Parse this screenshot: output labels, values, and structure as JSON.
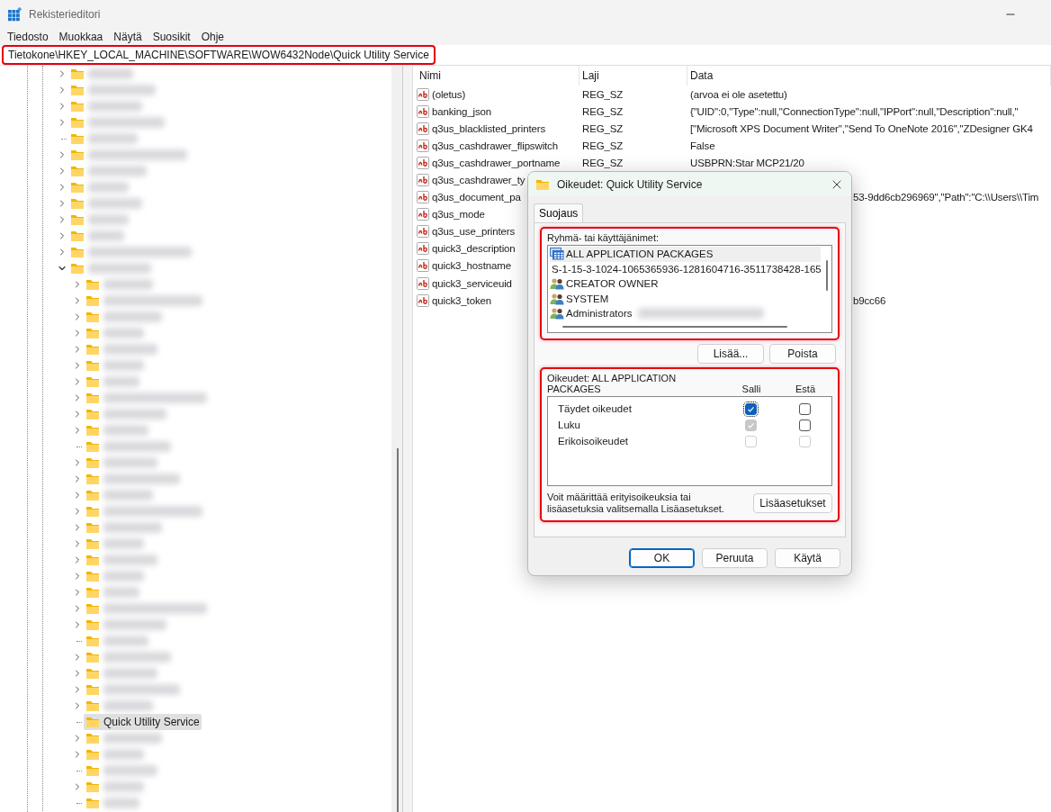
{
  "window": {
    "title": "Rekisterieditori"
  },
  "menu": [
    "Tiedosto",
    "Muokkaa",
    "Näytä",
    "Suosikit",
    "Ohje"
  ],
  "address_bar": {
    "value": "Tietokone\\HKEY_LOCAL_MACHINE\\SOFTWARE\\WOW6432Node\\Quick Utility Service",
    "highlighted": true
  },
  "tree": {
    "items": [
      {
        "expandable": true,
        "expanded": false,
        "redacted": true,
        "selected": false
      },
      {
        "expandable": true,
        "expanded": false,
        "redacted": true,
        "selected": false
      },
      {
        "expandable": true,
        "expanded": false,
        "redacted": true,
        "selected": false
      },
      {
        "expandable": true,
        "expanded": false,
        "redacted": true,
        "selected": false
      },
      {
        "expandable": false,
        "expanded": false,
        "redacted": true,
        "selected": false
      },
      {
        "expandable": true,
        "expanded": false,
        "redacted": true,
        "selected": false
      },
      {
        "expandable": true,
        "expanded": false,
        "redacted": true,
        "selected": false
      },
      {
        "expandable": true,
        "expanded": false,
        "redacted": true,
        "selected": false
      },
      {
        "expandable": true,
        "expanded": false,
        "redacted": true,
        "selected": false
      },
      {
        "expandable": true,
        "expanded": false,
        "redacted": true,
        "selected": false
      },
      {
        "expandable": true,
        "expanded": false,
        "redacted": true,
        "selected": false
      },
      {
        "expandable": true,
        "expanded": false,
        "redacted": true,
        "selected": false
      },
      {
        "expandable": true,
        "expanded": true,
        "redacted": true,
        "selected": false,
        "children": [
          {
            "expandable": true,
            "expanded": false,
            "redacted": true,
            "selected": false
          },
          {
            "expandable": true,
            "expanded": false,
            "redacted": true,
            "selected": false
          },
          {
            "expandable": true,
            "expanded": false,
            "redacted": true,
            "selected": false
          },
          {
            "expandable": true,
            "expanded": false,
            "redacted": true,
            "selected": false
          },
          {
            "expandable": true,
            "expanded": false,
            "redacted": true,
            "selected": false
          },
          {
            "expandable": true,
            "expanded": false,
            "redacted": true,
            "selected": false
          },
          {
            "expandable": true,
            "expanded": false,
            "redacted": true,
            "selected": false
          },
          {
            "expandable": true,
            "expanded": false,
            "redacted": true,
            "selected": false
          },
          {
            "expandable": true,
            "expanded": false,
            "redacted": true,
            "selected": false
          },
          {
            "expandable": true,
            "expanded": false,
            "redacted": true,
            "selected": false
          },
          {
            "expandable": false,
            "expanded": false,
            "redacted": true,
            "selected": false
          },
          {
            "expandable": true,
            "expanded": false,
            "redacted": true,
            "selected": false
          },
          {
            "expandable": true,
            "expanded": false,
            "redacted": true,
            "selected": false
          },
          {
            "expandable": true,
            "expanded": false,
            "redacted": true,
            "selected": false
          },
          {
            "expandable": true,
            "expanded": false,
            "redacted": true,
            "selected": false
          },
          {
            "expandable": true,
            "expanded": false,
            "redacted": true,
            "selected": false
          },
          {
            "expandable": true,
            "expanded": false,
            "redacted": true,
            "selected": false
          },
          {
            "expandable": true,
            "expanded": false,
            "redacted": true,
            "selected": false
          },
          {
            "expandable": true,
            "expanded": false,
            "redacted": true,
            "selected": false
          },
          {
            "expandable": true,
            "expanded": false,
            "redacted": true,
            "selected": false
          },
          {
            "expandable": true,
            "expanded": false,
            "redacted": true,
            "selected": false
          },
          {
            "expandable": true,
            "expanded": false,
            "redacted": true,
            "selected": false
          },
          {
            "expandable": false,
            "expanded": false,
            "redacted": true,
            "selected": false
          },
          {
            "expandable": true,
            "expanded": false,
            "redacted": true,
            "selected": false
          },
          {
            "expandable": true,
            "expanded": false,
            "redacted": true,
            "selected": false
          },
          {
            "expandable": true,
            "expanded": false,
            "redacted": true,
            "selected": false
          },
          {
            "expandable": true,
            "expanded": false,
            "redacted": true,
            "selected": false
          },
          {
            "label": "Quick Utility Service",
            "expandable": false,
            "expanded": false,
            "redacted": false,
            "selected": true
          },
          {
            "expandable": true,
            "expanded": false,
            "redacted": true,
            "selected": false
          },
          {
            "expandable": true,
            "expanded": false,
            "redacted": true,
            "selected": false
          },
          {
            "expandable": false,
            "expanded": false,
            "redacted": true,
            "selected": false
          },
          {
            "expandable": true,
            "expanded": false,
            "redacted": true,
            "selected": false
          },
          {
            "expandable": false,
            "expanded": false,
            "redacted": true,
            "selected": false
          }
        ]
      }
    ]
  },
  "values": {
    "columns": [
      "Nimi",
      "Laji",
      "Data"
    ],
    "rows": [
      {
        "kind": "full",
        "name": "(oletus)",
        "type": "REG_SZ",
        "data": "(arvoa ei ole asetettu)"
      },
      {
        "kind": "full",
        "name": "banking_json",
        "type": "REG_SZ",
        "data": "{\"UID\":0,\"Type\":null,\"ConnectionType\":null,\"IPPort\":null,\"Description\":null,\""
      },
      {
        "kind": "full",
        "name": "q3us_blacklisted_printers",
        "type": "REG_SZ",
        "data": "[\"Microsoft XPS Document Writer\",\"Send To OneNote 2016\",\"ZDesigner GK4"
      },
      {
        "kind": "full",
        "name": "q3us_cashdrawer_flipswitch",
        "type": "REG_SZ",
        "data": "False"
      },
      {
        "kind": "full",
        "name": "q3us_cashdrawer_portname",
        "type": "REG_SZ",
        "data": "USBPRN:Star MCP21/20"
      },
      {
        "kind": "covered",
        "name": "q3us_cashdrawer_ty"
      },
      {
        "kind": "covered",
        "name": "q3us_document_pa",
        "data": "53-9dd6cb296969\",\"Path\":\"C:\\\\Users\\\\Tim"
      },
      {
        "kind": "covered",
        "name": "q3us_mode"
      },
      {
        "kind": "covered",
        "name": "q3us_use_printers"
      },
      {
        "kind": "covered",
        "name": "quick3_description"
      },
      {
        "kind": "covered",
        "name": "quick3_hostname"
      },
      {
        "kind": "covered",
        "name": "quick3_serviceuid"
      },
      {
        "kind": "covered",
        "name": "quick3_token",
        "data": "b9cc66"
      }
    ]
  },
  "dialog": {
    "title": "Oikeudet: Quick Utility Service",
    "tabs": [
      {
        "label": "Suojaus",
        "selected": true
      }
    ],
    "groups": {
      "label": "Ryhmä- tai käyttäjänimet:",
      "highlighted": true,
      "items": [
        {
          "kind": "package",
          "name": "ALL APPLICATION PACKAGES",
          "selected": true
        },
        {
          "kind": "capability",
          "name": "S-1-15-3-1024-1065365936-1281604716-3511738428-165",
          "selected": false
        },
        {
          "kind": "group",
          "name": "CREATOR OWNER",
          "selected": false
        },
        {
          "kind": "group",
          "name": "SYSTEM",
          "selected": false
        },
        {
          "kind": "group",
          "name": "Administrators",
          "selected": false,
          "redacted": true
        }
      ]
    },
    "group_buttons": [
      "Lisää...",
      "Poista"
    ],
    "permissions": {
      "label": "Oikeudet: ALL APPLICATION PACKAGES",
      "highlighted": true,
      "allow_label": "Salli",
      "deny_label": "Estä",
      "rows": [
        {
          "name": "Täydet oikeudet",
          "allow": {
            "checked": true,
            "disabled": false,
            "focused": true
          },
          "deny": {
            "checked": false,
            "disabled": false,
            "focused": false
          }
        },
        {
          "name": "Luku",
          "allow": {
            "checked": true,
            "disabled": true,
            "focused": false
          },
          "deny": {
            "checked": false,
            "disabled": false,
            "focused": false
          }
        },
        {
          "name": "Erikoisoikeudet",
          "allow": {
            "checked": false,
            "disabled": true,
            "focused": false
          },
          "deny": {
            "checked": false,
            "disabled": true,
            "focused": false
          }
        }
      ],
      "note": "Voit määrittää erityisoikeuksia tai lisäasetuksia valitsemalla Lisäasetukset.",
      "advanced_button": "Lisäasetukset"
    },
    "buttons": [
      {
        "label": "OK",
        "default": true
      },
      {
        "label": "Peruuta",
        "default": false
      },
      {
        "label": "Käytä",
        "default": false
      }
    ]
  }
}
